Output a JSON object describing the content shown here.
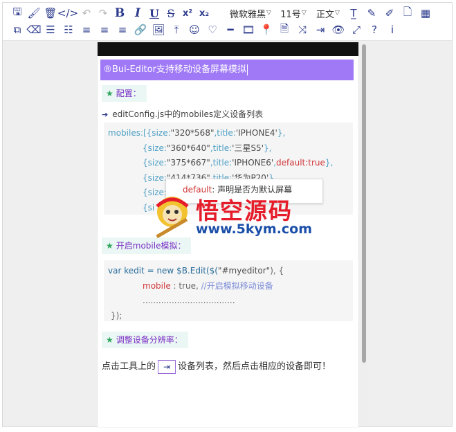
{
  "toolbar": {
    "row1": [
      {
        "name": "save-icon",
        "glyph": "🖫"
      },
      {
        "name": "brush-icon",
        "glyph": "🖌"
      },
      {
        "name": "trash-icon",
        "glyph": "🗑"
      },
      {
        "name": "code-icon",
        "glyph": "</>"
      },
      {
        "name": "undo-icon",
        "glyph": "↶"
      },
      {
        "name": "redo-icon",
        "glyph": "↷"
      },
      {
        "name": "bold-icon",
        "glyph": "B"
      },
      {
        "name": "italic-icon",
        "glyph": "I"
      },
      {
        "name": "underline-icon",
        "glyph": "U"
      },
      {
        "name": "strikethrough-icon",
        "glyph": "S"
      },
      {
        "name": "superscript-icon",
        "glyph": "x²"
      },
      {
        "name": "subscript-icon",
        "glyph": "x₂"
      }
    ],
    "font_family": "微软雅黑",
    "font_size": "11号",
    "paragraph": "正文",
    "row1_tail": [
      {
        "name": "clear-format-icon",
        "glyph": "T̲"
      },
      {
        "name": "highlight-icon",
        "glyph": "✎"
      },
      {
        "name": "edit-icon",
        "glyph": "✐"
      },
      {
        "name": "document-icon",
        "glyph": "🗋"
      },
      {
        "name": "table-icon",
        "glyph": "▦"
      }
    ],
    "row2": [
      {
        "name": "copy-icon",
        "glyph": "⧉"
      },
      {
        "name": "eraser-icon",
        "glyph": "⌫"
      },
      {
        "name": "ordered-list-icon",
        "glyph": "☰"
      },
      {
        "name": "unordered-list-icon",
        "glyph": "☷"
      },
      {
        "name": "align-center-icon",
        "glyph": "≡"
      },
      {
        "name": "align-left-icon",
        "glyph": "≡"
      },
      {
        "name": "align-right-icon",
        "glyph": "≡"
      },
      {
        "name": "link-icon",
        "glyph": "🔗"
      },
      {
        "name": "image-icon",
        "glyph": "🖼"
      },
      {
        "name": "upload-icon",
        "glyph": "⤒"
      },
      {
        "name": "emoji-icon",
        "glyph": "☺"
      },
      {
        "name": "heart-icon",
        "glyph": "♡"
      },
      {
        "name": "horizontal-rule-icon",
        "glyph": "━"
      },
      {
        "name": "video-icon",
        "glyph": "🎞"
      },
      {
        "name": "location-icon",
        "glyph": "📍"
      },
      {
        "name": "html-icon",
        "glyph": "🗎"
      },
      {
        "name": "shuffle-icon",
        "glyph": "⤨"
      },
      {
        "name": "device-icon",
        "glyph": "⇥"
      },
      {
        "name": "preview-icon",
        "glyph": "👁"
      },
      {
        "name": "fullscreen-icon",
        "glyph": "⤢"
      },
      {
        "name": "help-icon",
        "glyph": "?"
      },
      {
        "name": "info-icon",
        "glyph": "i"
      }
    ]
  },
  "editor": {
    "title": "®Bui-Editor支持移动设备屏幕模拟",
    "heading1": "配置：",
    "bullet": "editConfig.js中的mobiles定义设备列表",
    "code1": [
      [
        "mobiles:[{size:",
        "\"320*568\"",
        ",title:",
        "'IPHONE4'",
        "},",
        "",
        ""
      ],
      [
        "{size:",
        "\"360*640\"",
        ",title:",
        "'三星S5'",
        "},",
        "",
        ""
      ],
      [
        "{size:",
        "\"375*667\"",
        ",title:",
        "'IPHONE6'",
        ",",
        "default:true",
        "},"
      ],
      [
        "{size:",
        "\"414*736\"",
        ",title:",
        "'华为P20'",
        "},",
        "",
        ""
      ],
      [
        "{size:",
        "",
        "",
        "",
        "",
        "",
        ""
      ],
      [
        "{si",
        "",
        "",
        "",
        "",
        "",
        ""
      ]
    ],
    "tooltip_key": "default",
    "tooltip_text": ": 声明是否为默认屏幕",
    "heading2": "开启mobile模拟：",
    "code2_line1_a": "var kedit = new $B.Edit($(",
    "code2_line1_b": "\"#myeditor\"",
    "code2_line1_c": "), {",
    "code2_line2_key": "mobile",
    "code2_line2_val": " : true, ",
    "code2_line2_cmt": "//开启模拟移动设备",
    "code2_line3": "...................................",
    "code2_line4": "});",
    "heading3": "调整设备分辨率：",
    "para_before": "点击工具上的",
    "para_after": "设备列表，然后点击相应的设备即可！"
  },
  "watermark": {
    "title": "悟空源码",
    "url": "www.5kym.com"
  }
}
